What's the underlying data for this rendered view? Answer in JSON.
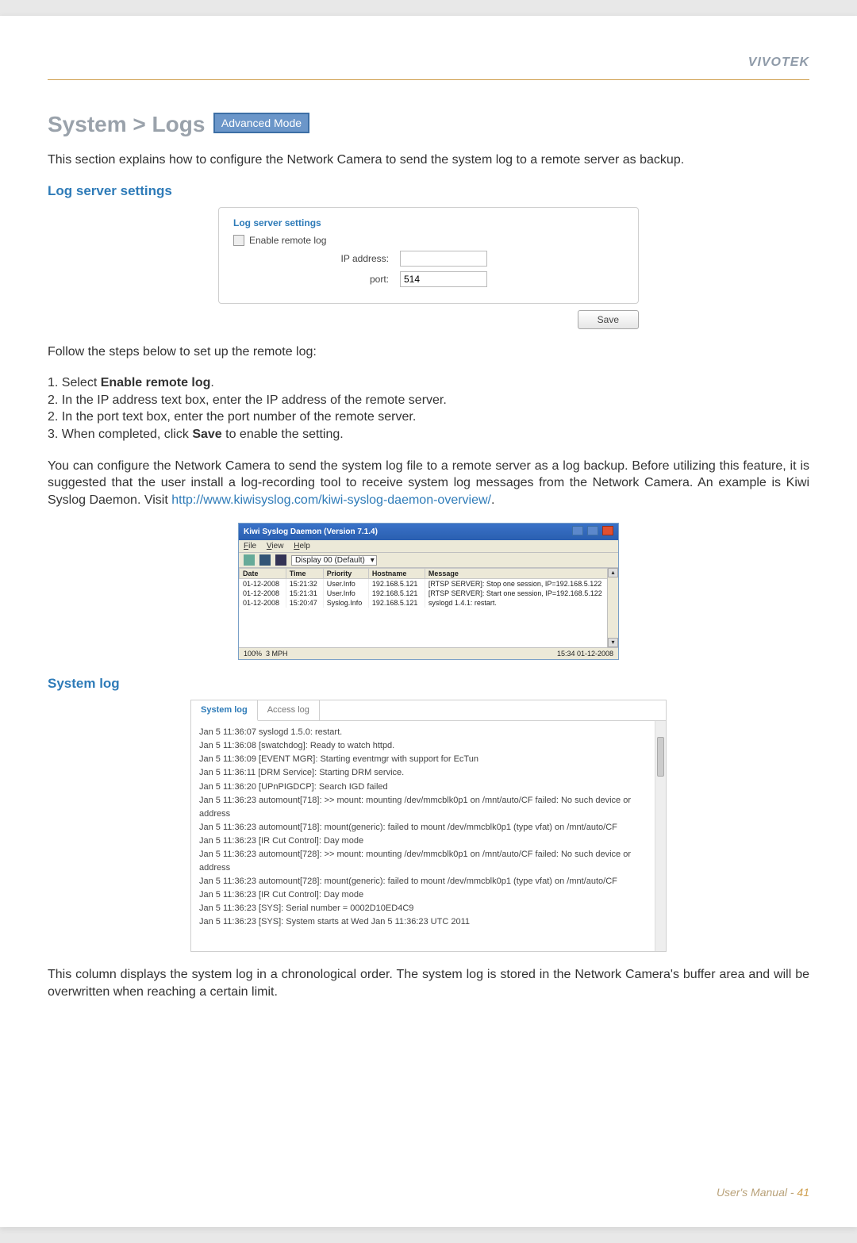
{
  "brand": "VIVOTEK",
  "title": "System > Logs",
  "adv_badge": "Advanced Mode",
  "intro": "This section explains how to configure the Network Camera to send the system log to a remote server as backup.",
  "log_server": {
    "heading": "Log server settings",
    "legend": "Log server settings",
    "enable_label": "Enable remote log",
    "ip_label": "IP address:",
    "ip_value": "",
    "port_label": "port:",
    "port_value": "514",
    "save": "Save"
  },
  "follow": "Follow the steps below to set up the remote log:",
  "steps": [
    {
      "n": "1.",
      "pre": "Select ",
      "bold": "Enable remote log",
      "post": "."
    },
    {
      "n": "2.",
      "pre": "In the IP address text box, enter the IP address of the remote server.",
      "bold": "",
      "post": ""
    },
    {
      "n": "2.",
      "pre": "In the port text box, enter the port number of the remote server.",
      "bold": "",
      "post": ""
    },
    {
      "n": "3.",
      "pre": "When completed, click ",
      "bold": "Save",
      "post": " to enable the setting."
    }
  ],
  "para_after": "You can configure the Network Camera to send the system log file to a remote server as a log backup. Before utilizing this feature, it is suggested that the user install a log-recording tool to receive system log messages from the Network Camera. An example is Kiwi Syslog Daemon. Visit ",
  "link": "http://www.kiwisyslog.com/kiwi-syslog-daemon-overview/",
  "link_end": ".",
  "kiwi": {
    "title": "Kiwi Syslog Daemon (Version 7.1.4)",
    "menu": {
      "file": "File",
      "view": "View",
      "help": "Help"
    },
    "display": "Display 00 (Default)",
    "cols": [
      "Date",
      "Time",
      "Priority",
      "Hostname",
      "Message"
    ],
    "rows": [
      [
        "01-12-2008",
        "15:21:32",
        "User.Info",
        "192.168.5.121",
        "[RTSP SERVER]: Stop one session, IP=192.168.5.122"
      ],
      [
        "01-12-2008",
        "15:21:31",
        "User.Info",
        "192.168.5.121",
        "[RTSP SERVER]: Start one session, IP=192.168.5.122"
      ],
      [
        "01-12-2008",
        "15:20:47",
        "Syslog.Info",
        "192.168.5.121",
        "syslogd 1.4.1: restart."
      ]
    ],
    "status_left": "100%",
    "status_mid": "3 MPH",
    "status_right": "15:34    01-12-2008"
  },
  "syslog_heading": "System log",
  "tabs": {
    "active": "System log",
    "other": "Access log"
  },
  "loglines": [
    "Jan 5 11:36:07 syslogd 1.5.0: restart.",
    "Jan 5 11:36:08 [swatchdog]: Ready to watch httpd.",
    "Jan 5 11:36:09 [EVENT MGR]: Starting eventmgr with support for EcTun",
    "Jan 5 11:36:11 [DRM Service]: Starting DRM service.",
    "Jan 5 11:36:20 [UPnPIGDCP]: Search IGD failed",
    "Jan 5 11:36:23 automount[718]: >> mount: mounting /dev/mmcblk0p1 on /mnt/auto/CF failed: No such device or address",
    "Jan 5 11:36:23 automount[718]: mount(generic): failed to mount /dev/mmcblk0p1 (type vfat) on /mnt/auto/CF",
    "Jan 5 11:36:23 [IR Cut Control]: Day mode",
    "Jan 5 11:36:23 automount[728]: >> mount: mounting /dev/mmcblk0p1 on /mnt/auto/CF failed: No such device or address",
    "Jan 5 11:36:23 automount[728]: mount(generic): failed to mount /dev/mmcblk0p1 (type vfat) on /mnt/auto/CF",
    "Jan 5 11:36:23 [IR Cut Control]: Day mode",
    "Jan 5 11:36:23 [SYS]: Serial number = 0002D10ED4C9",
    "Jan 5 11:36:23 [SYS]: System starts at Wed Jan 5 11:36:23 UTC 2011"
  ],
  "closing": "This column displays the system log in a chronological order. The system log is stored in the Network Camera's buffer area and will be overwritten when reaching a certain limit.",
  "footer_label": "User's Manual - ",
  "footer_page": "41"
}
